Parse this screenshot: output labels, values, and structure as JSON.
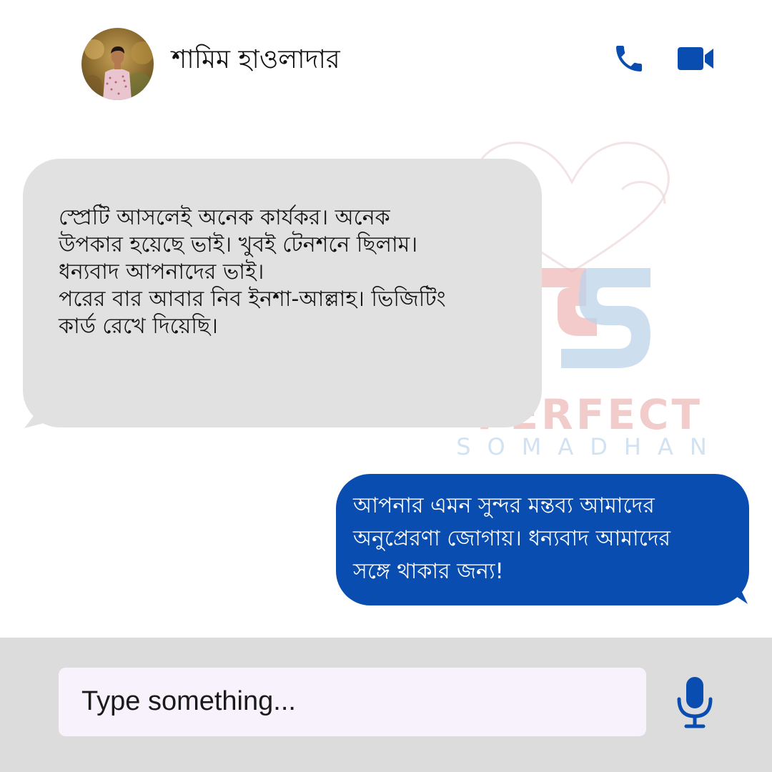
{
  "header": {
    "contact_name": "শামিম হাওলাদার",
    "call_icon": "phone-icon",
    "video_icon": "video-camera-icon"
  },
  "watermark": {
    "logo_icon": "ps-monogram-logo",
    "brand_line1": "PERFECT",
    "brand_line2": "SOMADHAN"
  },
  "messages": [
    {
      "direction": "incoming",
      "lines": [
        "স্প্রেটি আসলেই অনেক কার্যকর। অনেক",
        "উপকার হয়েছে ভাই। খুবই টেনশনে ছিলাম।",
        "ধন্যবাদ আপনাদের ভাই।",
        "পরের বার আবার নিব ইনশা-আল্লাহ। ভিজিটিং",
        "কার্ড রেখে দিয়েছি।"
      ]
    },
    {
      "direction": "outgoing",
      "lines": [
        "আপনার এমন সুন্দর মন্তব্য আমাদের",
        "অনুপ্রেরণা জোগায়। ধন্যবাদ আমাদের",
        "সঙ্গে থাকার জন্য!"
      ]
    }
  ],
  "composer": {
    "placeholder": "Type something...",
    "mic_icon": "microphone-icon"
  },
  "colors": {
    "accent": "#0a4db1",
    "incoming_bubble": "#e1e1e1",
    "outgoing_bubble": "#0a4db1",
    "composer_bar": "#dcdcdc",
    "input_background": "#f7f2fb"
  }
}
